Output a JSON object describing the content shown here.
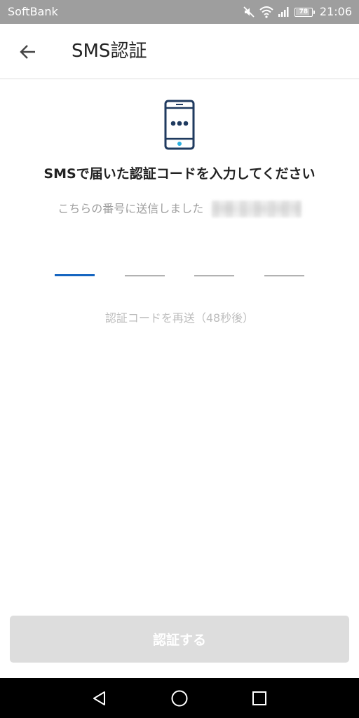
{
  "status_bar": {
    "carrier": "SoftBank",
    "battery": "78",
    "time": "21:06",
    "icons": [
      "mute-icon",
      "wifi-icon",
      "signal-icon",
      "battery-icon"
    ]
  },
  "app_bar": {
    "back_icon": "arrow-left-icon",
    "title": "SMS認証"
  },
  "content": {
    "illustration_icon": "smartphone-icon",
    "instruction": "SMSで届いた認証コードを入力してください",
    "sent_to_text": "こちらの番号に送信しました",
    "phone_number": "090-1234-5678",
    "code_slots": [
      "",
      "",
      "",
      ""
    ],
    "active_slot": 0,
    "resend_text": "認証コードを再送（48秒後）"
  },
  "actions": {
    "verify_label": "認証する"
  },
  "nav_bar": {
    "icons": [
      "nav-back-icon",
      "nav-home-icon",
      "nav-recent-icon"
    ]
  },
  "colors": {
    "status_bar_bg": "#9e9e9e",
    "accent": "#1565c0",
    "illustration_stroke": "#1f3a5f",
    "illustration_dot": "#2bb0e0",
    "disabled_button": "#dddddd",
    "muted_text": "#9e9e9e"
  }
}
